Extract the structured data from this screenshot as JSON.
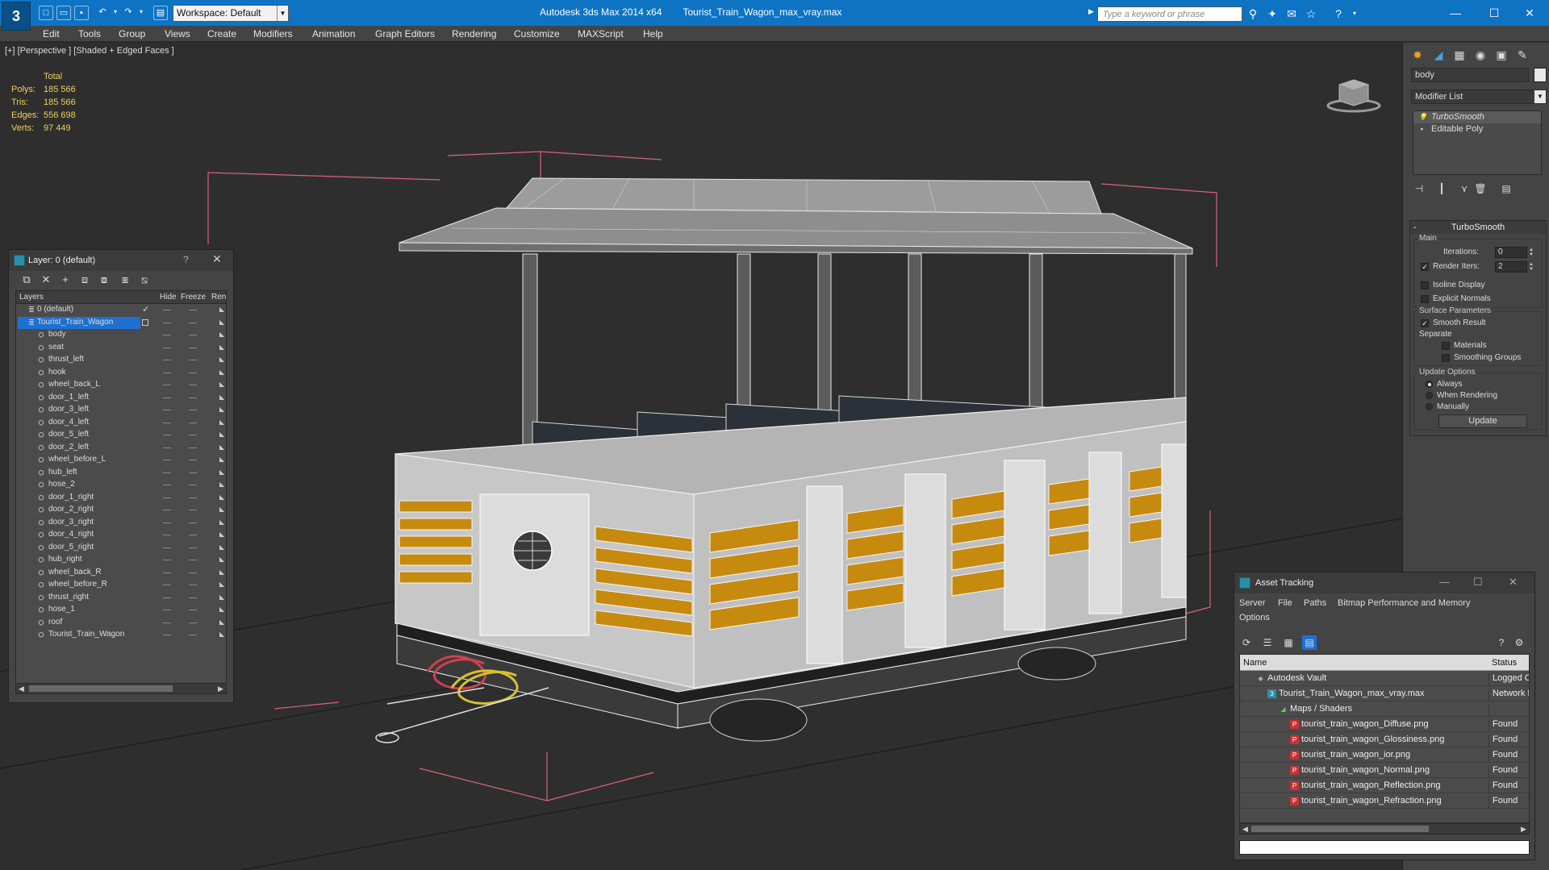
{
  "titlebar": {
    "app_name": "Autodesk 3ds Max  2014 x64",
    "file_name": "Tourist_Train_Wagon_max_vray.max",
    "workspace": "Workspace: Default",
    "search_placeholder": "Type a keyword or phrase",
    "logo": "3"
  },
  "menu": [
    "Edit",
    "Tools",
    "Group",
    "Views",
    "Create",
    "Modifiers",
    "Animation",
    "Graph Editors",
    "Rendering",
    "Customize",
    "MAXScript",
    "Help"
  ],
  "viewport": {
    "label": "[+] [Perspective ] [Shaded + Edged Faces ]",
    "stats": {
      "header": "Total",
      "rows": [
        {
          "label": "Polys:",
          "value": "185 566"
        },
        {
          "label": "Tris:",
          "value": "185 566"
        },
        {
          "label": "Edges:",
          "value": "556 698"
        },
        {
          "label": "Verts:",
          "value": "97 449"
        }
      ]
    },
    "colors": {
      "wireframe": "#f0f0f0",
      "panel_fill": "#c68a0f",
      "bounding_box": "#d9627e",
      "background": "#2e2e2e"
    }
  },
  "command_panel": {
    "object_name": "body",
    "modifier_list": "Modifier List",
    "stack": [
      "TurboSmooth",
      "Editable Poly"
    ],
    "rollout_title": "TurboSmooth",
    "main_group": "Main",
    "iterations_label": "Iterations:",
    "iterations_value": "0",
    "render_iters_label": "Render Iters:",
    "render_iters_value": "2",
    "isoline_display": "Isoline Display",
    "explicit_normals": "Explicit Normals",
    "surface_params_group": "Surface Parameters",
    "smooth_result": "Smooth Result",
    "separate_label": "Separate",
    "materials": "Materials",
    "smoothing_groups": "Smoothing Groups",
    "update_options_group": "Update Options",
    "always": "Always",
    "when_rendering": "When Rendering",
    "manually": "Manually",
    "update_button": "Update"
  },
  "layer_dialog": {
    "title": "Layer: 0 (default)",
    "help": "?",
    "columns": {
      "layers": "Layers",
      "hide": "Hide",
      "freeze": "Freeze",
      "render": "Rend"
    },
    "top_layers": [
      {
        "name": "0 (default)",
        "active": true
      },
      {
        "name": "Tourist_Train_Wagon",
        "selected": true
      }
    ],
    "objects": [
      "body",
      "seat",
      "thrust_left",
      "hook",
      "wheel_back_L",
      "door_1_left",
      "door_3_left",
      "door_4_left",
      "door_5_left",
      "door_2_left",
      "wheel_before_L",
      "hub_left",
      "hose_2",
      "door_1_right",
      "door_2_right",
      "door_3_right",
      "door_4_right",
      "door_5_right",
      "hub_right",
      "wheel_back_R",
      "wheel_before_R",
      "thrust_right",
      "hose_1",
      "roof",
      "Tourist_Train_Wagon"
    ]
  },
  "asset_dialog": {
    "title": "Asset Tracking",
    "menu": [
      "Server",
      "File",
      "Paths",
      "Bitmap Performance and Memory",
      "Options"
    ],
    "columns": {
      "name": "Name",
      "status": "Status"
    },
    "rows": [
      {
        "name": "Autodesk Vault",
        "status": "Logged O",
        "indent": 1,
        "icon": "vault-icon"
      },
      {
        "name": "Tourist_Train_Wagon_max_vray.max",
        "status": "Network I",
        "indent": 2,
        "icon": "max-file-icon"
      },
      {
        "name": "Maps / Shaders",
        "status": "",
        "indent": 3,
        "icon": "maps-icon"
      },
      {
        "name": "tourist_train_wagon_Diffuse.png",
        "status": "Found",
        "indent": 4,
        "icon": "png-icon"
      },
      {
        "name": "tourist_train_wagon_Glossiness.png",
        "status": "Found",
        "indent": 4,
        "icon": "png-icon"
      },
      {
        "name": "tourist_train_wagon_ior.png",
        "status": "Found",
        "indent": 4,
        "icon": "png-icon"
      },
      {
        "name": "tourist_train_wagon_Normal.png",
        "status": "Found",
        "indent": 4,
        "icon": "png-icon"
      },
      {
        "name": "tourist_train_wagon_Reflection.png",
        "status": "Found",
        "indent": 4,
        "icon": "png-icon"
      },
      {
        "name": "tourist_train_wagon_Refraction.png",
        "status": "Found",
        "indent": 4,
        "icon": "png-icon"
      }
    ]
  }
}
